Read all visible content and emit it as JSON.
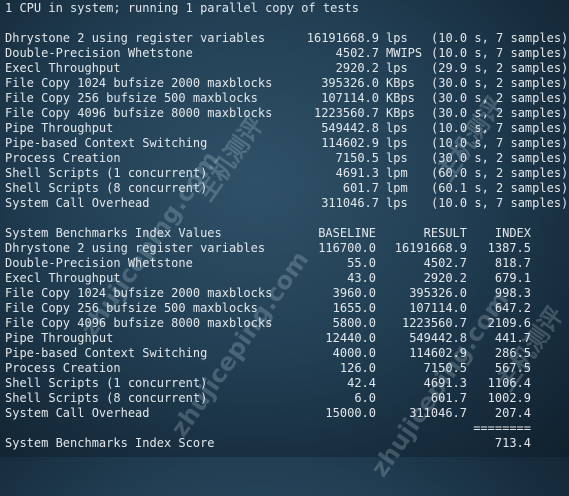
{
  "header": "1 CPU in system; running 1 parallel copy of tests",
  "results": [
    {
      "name": "Dhrystone 2 using register variables",
      "value": "16191668.9",
      "unit": "lps",
      "info": "(10.0 s, 7 samples)"
    },
    {
      "name": "Double-Precision Whetstone",
      "value": "4502.7",
      "unit": "MWIPS",
      "info": "(10.0 s, 7 samples)"
    },
    {
      "name": "Execl Throughput",
      "value": "2920.2",
      "unit": "lps",
      "info": "(29.9 s, 2 samples)"
    },
    {
      "name": "File Copy 1024 bufsize 2000 maxblocks",
      "value": "395326.0",
      "unit": "KBps",
      "info": "(30.0 s, 2 samples)"
    },
    {
      "name": "File Copy 256 bufsize 500 maxblocks",
      "value": "107114.0",
      "unit": "KBps",
      "info": "(30.0 s, 2 samples)"
    },
    {
      "name": "File Copy 4096 bufsize 8000 maxblocks",
      "value": "1223560.7",
      "unit": "KBps",
      "info": "(30.0 s, 2 samples)"
    },
    {
      "name": "Pipe Throughput",
      "value": "549442.8",
      "unit": "lps",
      "info": "(10.0 s, 7 samples)"
    },
    {
      "name": "Pipe-based Context Switching",
      "value": "114602.9",
      "unit": "lps",
      "info": "(10.0 s, 7 samples)"
    },
    {
      "name": "Process Creation",
      "value": "7150.5",
      "unit": "lps",
      "info": "(30.0 s, 2 samples)"
    },
    {
      "name": "Shell Scripts (1 concurrent)",
      "value": "4691.3",
      "unit": "lpm",
      "info": "(60.0 s, 2 samples)"
    },
    {
      "name": "Shell Scripts (8 concurrent)",
      "value": "601.7",
      "unit": "lpm",
      "info": "(60.1 s, 2 samples)"
    },
    {
      "name": "System Call Overhead",
      "value": "311046.7",
      "unit": "lps",
      "info": "(10.0 s, 7 samples)"
    }
  ],
  "index_header": {
    "title": "System Benchmarks Index Values",
    "baseline": "BASELINE",
    "result": "RESULT",
    "index": "INDEX"
  },
  "index_rows": [
    {
      "name": "Dhrystone 2 using register variables",
      "baseline": "116700.0",
      "result": "16191668.9",
      "index": "1387.5"
    },
    {
      "name": "Double-Precision Whetstone",
      "baseline": "55.0",
      "result": "4502.7",
      "index": "818.7"
    },
    {
      "name": "Execl Throughput",
      "baseline": "43.0",
      "result": "2920.2",
      "index": "679.1"
    },
    {
      "name": "File Copy 1024 bufsize 2000 maxblocks",
      "baseline": "3960.0",
      "result": "395326.0",
      "index": "998.3"
    },
    {
      "name": "File Copy 256 bufsize 500 maxblocks",
      "baseline": "1655.0",
      "result": "107114.0",
      "index": "647.2"
    },
    {
      "name": "File Copy 4096 bufsize 8000 maxblocks",
      "baseline": "5800.0",
      "result": "1223560.7",
      "index": "2109.6"
    },
    {
      "name": "Pipe Throughput",
      "baseline": "12440.0",
      "result": "549442.8",
      "index": "441.7"
    },
    {
      "name": "Pipe-based Context Switching",
      "baseline": "4000.0",
      "result": "114602.9",
      "index": "286.5"
    },
    {
      "name": "Process Creation",
      "baseline": "126.0",
      "result": "7150.5",
      "index": "567.5"
    },
    {
      "name": "Shell Scripts (1 concurrent)",
      "baseline": "42.4",
      "result": "4691.3",
      "index": "1106.4"
    },
    {
      "name": "Shell Scripts (8 concurrent)",
      "baseline": "6.0",
      "result": "601.7",
      "index": "1002.9"
    },
    {
      "name": "System Call Overhead",
      "baseline": "15000.0",
      "result": "311046.7",
      "index": "207.4"
    }
  ],
  "separator": "========",
  "score": {
    "label": "System Benchmarks Index Score",
    "value": "713.4"
  },
  "watermark": [
    "zhujiceping.com",
    "主机测评",
    "zhujiceping.com",
    "主机测评",
    "zhujiceping.com",
    "主机测评"
  ]
}
